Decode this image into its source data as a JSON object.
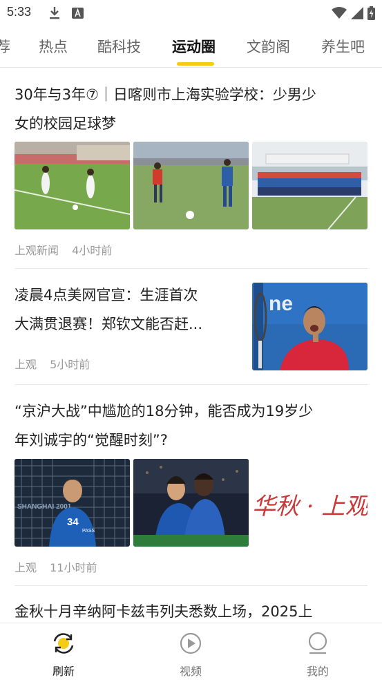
{
  "status_bar": {
    "time": "5:33"
  },
  "tabs": [
    {
      "label": "荐",
      "active": false
    },
    {
      "label": "热点",
      "active": false
    },
    {
      "label": "酷科技",
      "active": false
    },
    {
      "label": "运动圈",
      "active": true
    },
    {
      "label": "文韵阁",
      "active": false
    },
    {
      "label": "养生吧",
      "active": false
    }
  ],
  "articles": [
    {
      "title_line1": "30年与3年⑦｜日喀则市上海实验学校：少男少",
      "title_line2": "女的校园足球梦",
      "source": "上观新闻",
      "time": "4小时前"
    },
    {
      "title_line1": "凌晨4点美网官宣：生涯首次",
      "title_line2": "大满贯退赛！郑钦文能否赶...",
      "source": "上观",
      "time": "5小时前"
    },
    {
      "title_line1": "“京沪大战”中尴尬的18分钟，能否成为19岁少",
      "title_line2": "年刘诚宇的“觉醒时刻”?",
      "source": "上观",
      "time": "11小时前",
      "jersey_number": "34",
      "jersey_sponsor": "PASS",
      "bg_text": "SHANGHAI 2001",
      "banner_text": "华秋 · 上观"
    },
    {
      "title_line1": "金秋十月辛纳阿卡兹韦列夫悉数上场，2025上"
    }
  ],
  "bottom_nav": [
    {
      "label": "刷新",
      "icon": "refresh-icon",
      "active": true
    },
    {
      "label": "视频",
      "icon": "video-play-icon",
      "active": false
    },
    {
      "label": "我的",
      "icon": "profile-icon",
      "active": false
    }
  ],
  "colors": {
    "accent": "#f5cc14",
    "meta_text": "#999999"
  }
}
